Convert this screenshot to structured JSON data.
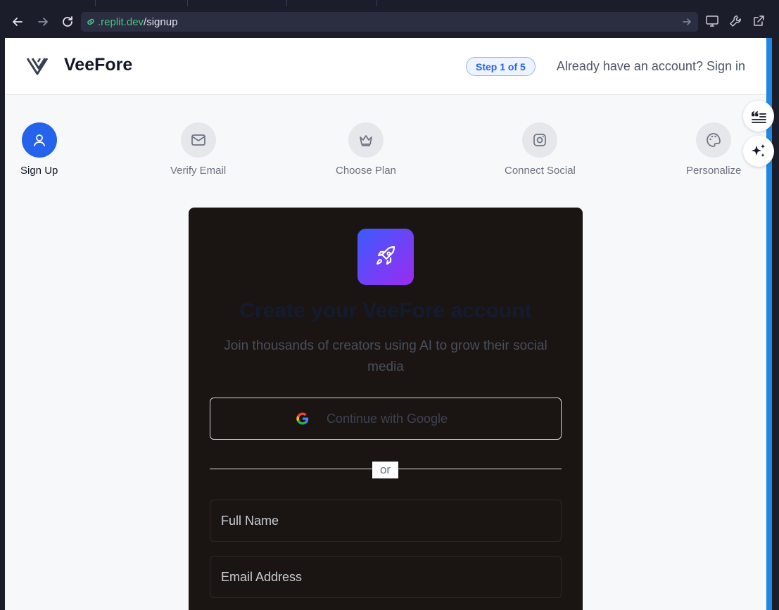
{
  "browser": {
    "url_domain": ".replit.dev",
    "url_path": "/signup"
  },
  "header": {
    "brand": "VeeFore",
    "step_indicator": "Step 1 of 5",
    "signin_text": "Already have an account? Sign in"
  },
  "steps": [
    {
      "label": "Sign Up",
      "icon": "user-icon",
      "active": true
    },
    {
      "label": "Verify Email",
      "icon": "mail-icon",
      "active": false
    },
    {
      "label": "Choose Plan",
      "icon": "crown-icon",
      "active": false
    },
    {
      "label": "Connect Social",
      "icon": "instagram-icon",
      "active": false
    },
    {
      "label": "Personalize",
      "icon": "palette-icon",
      "active": false
    }
  ],
  "card": {
    "title": "Create your VeeFore account",
    "subtitle": "Join thousands of creators using AI to grow their social media",
    "google_label": "Continue with Google",
    "divider_label": "or",
    "fields": {
      "full_name_placeholder": "Full Name",
      "email_placeholder": "Email Address"
    }
  },
  "colors": {
    "accent": "#2563eb",
    "card_bg": "#1a1513",
    "gradient_start": "#3b5bfd",
    "gradient_end": "#9b2cf0"
  }
}
